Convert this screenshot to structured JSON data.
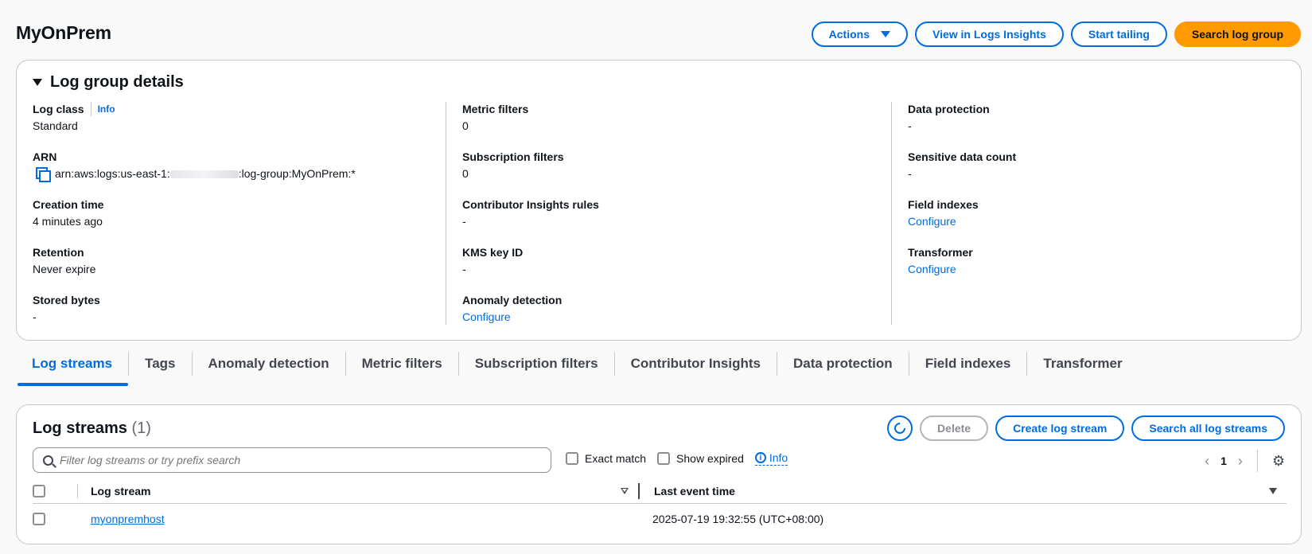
{
  "page": {
    "title": "MyOnPrem"
  },
  "header_actions": {
    "actions": "Actions",
    "view_insights": "View in Logs Insights",
    "start_tailing": "Start tailing",
    "search_group": "Search log group"
  },
  "details": {
    "title": "Log group details",
    "log_class_label": "Log class",
    "log_class_info": "Info",
    "log_class_value": "Standard",
    "arn_label": "ARN",
    "arn_prefix": "arn:aws:logs:us-east-1:",
    "arn_suffix": ":log-group:MyOnPrem:*",
    "creation_label": "Creation time",
    "creation_value": "4 minutes ago",
    "retention_label": "Retention",
    "retention_value": "Never expire",
    "stored_label": "Stored bytes",
    "stored_value": "-",
    "metric_label": "Metric filters",
    "metric_value": "0",
    "subscription_label": "Subscription filters",
    "subscription_value": "0",
    "contributor_label": "Contributor Insights rules",
    "contributor_value": "-",
    "kms_label": "KMS key ID",
    "kms_value": "-",
    "anomaly_label": "Anomaly detection",
    "anomaly_value": "Configure",
    "protection_label": "Data protection",
    "protection_value": "-",
    "sensitive_label": "Sensitive data count",
    "sensitive_value": "-",
    "indexes_label": "Field indexes",
    "indexes_value": "Configure",
    "transformer_label": "Transformer",
    "transformer_value": "Configure"
  },
  "tabs": [
    "Log streams",
    "Tags",
    "Anomaly detection",
    "Metric filters",
    "Subscription filters",
    "Contributor Insights",
    "Data protection",
    "Field indexes",
    "Transformer"
  ],
  "streams": {
    "title": "Log streams",
    "count": "(1)",
    "delete": "Delete",
    "create": "Create log stream",
    "search_all": "Search all log streams",
    "search_placeholder": "Filter log streams or try prefix search",
    "exact_match": "Exact match",
    "show_expired": "Show expired",
    "info": "Info",
    "page": "1",
    "col_stream": "Log stream",
    "col_time": "Last event time",
    "rows": [
      {
        "stream": "myonpremhost",
        "time": "2025-07-19 19:32:55 (UTC+08:00)"
      }
    ]
  },
  "colors": {
    "accent": "#006ce0",
    "primary": "#ff9900",
    "border": "#c6c6cd"
  }
}
